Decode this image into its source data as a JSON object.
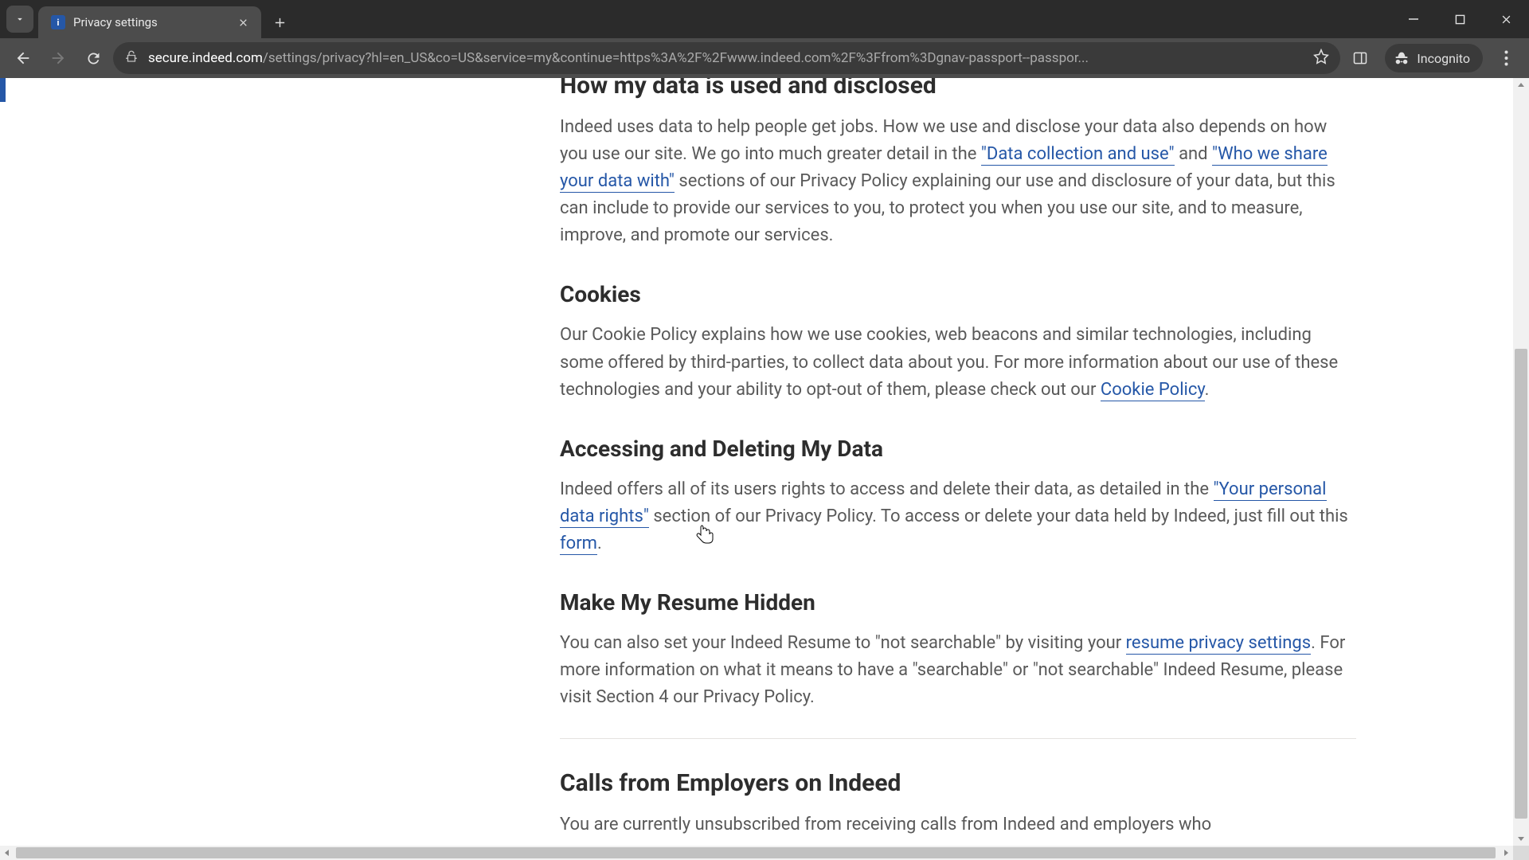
{
  "tab": {
    "title": "Privacy settings"
  },
  "address": {
    "domain": "secure.indeed.com",
    "path": "/settings/privacy?hl=en_US&co=US&service=my&continue=https%3A%2F%2Fwww.indeed.com%2F%3Ffrom%3Dgnav-passport--passpor..."
  },
  "incognito_label": "Incognito",
  "sections": {
    "data_used": {
      "title": "How my data is used and disclosed",
      "p1a": "Indeed uses data to help people get jobs. How we use and disclose your data also depends on how you use our site. We go into much greater detail in the ",
      "link1": "\"Data collection and use\"",
      "p1b": " and ",
      "link2": "\"Who we share your data with\"",
      "p1c": " sections of our Privacy Policy explaining our use and disclosure of your data, but this can include to provide our services to you, to protect you when you use our site, and to measure, improve, and promote our services."
    },
    "cookies": {
      "title": "Cookies",
      "p1a": "Our Cookie Policy explains how we use cookies, web beacons and similar technologies, including some offered by third-parties, to collect data about you. For more information about our use of these technologies and your ability to opt-out of them, please check out our ",
      "link1": "Cookie Policy",
      "p1b": "."
    },
    "accessing": {
      "title": "Accessing and Deleting My Data",
      "p1a": "Indeed offers all of its users rights to access and delete their data, as detailed in the ",
      "link1": "\"Your personal data rights\"",
      "p1b": " section of our Privacy Policy. To access or delete your data held by Indeed, just fill out this ",
      "link2": "form",
      "p1c": "."
    },
    "resume": {
      "title": "Make My Resume Hidden",
      "p1a": "You can also set your Indeed Resume to \"not searchable\" by visiting your ",
      "link1": "resume privacy settings",
      "p1b": ". For more information on what it means to have a \"searchable\" or \"not searchable\" Indeed Resume, please visit Section 4 our Privacy Policy."
    },
    "calls": {
      "title": "Calls from Employers on Indeed",
      "p1": "You are currently unsubscribed from receiving calls from Indeed and employers who"
    }
  }
}
